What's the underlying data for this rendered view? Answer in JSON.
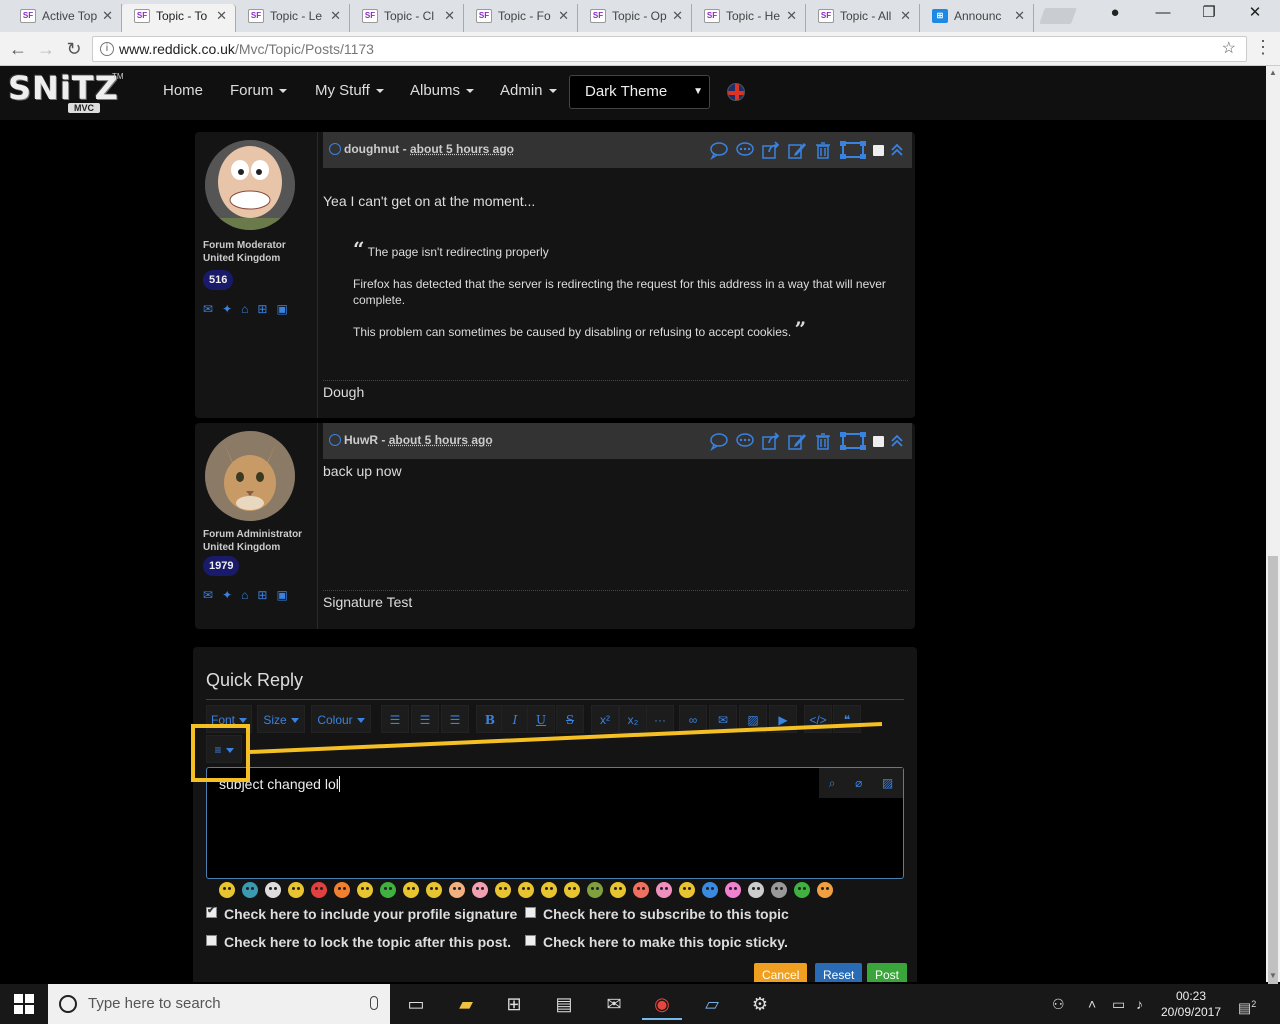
{
  "browser": {
    "tabs": [
      {
        "label": "Active Top",
        "favicon": "SF",
        "active": false
      },
      {
        "label": "Topic - To",
        "favicon": "SF",
        "active": true
      },
      {
        "label": "Topic - Le",
        "favicon": "SF",
        "active": false
      },
      {
        "label": "Topic - Cl",
        "favicon": "SF",
        "active": false
      },
      {
        "label": "Topic - Fo",
        "favicon": "SF",
        "active": false
      },
      {
        "label": "Topic - Op",
        "favicon": "SF",
        "active": false
      },
      {
        "label": "Topic - He",
        "favicon": "SF",
        "active": false
      },
      {
        "label": "Topic - All",
        "favicon": "SF",
        "active": false
      },
      {
        "label": "Announc",
        "favicon": "win",
        "active": false
      }
    ],
    "url_host": "www.reddick.co.uk",
    "url_path": "/Mvc/Topic/Posts/1173"
  },
  "site": {
    "logo_text": "SNiTZ",
    "logo_sub": "MVC",
    "logo_tm": "TM",
    "nav": [
      "Home",
      "Forum",
      "My Stuff",
      "Albums",
      "Admin"
    ],
    "nav_dropdowns": [
      false,
      true,
      true,
      true,
      true
    ],
    "theme_select": "Dark Theme"
  },
  "posts": [
    {
      "author": "doughnut",
      "separator": "-",
      "time": "about 5 hours ago",
      "rank": "Forum Moderator",
      "country": "United Kingdom",
      "post_count": "516",
      "body": "Yea I can't get on at the moment...",
      "quote": [
        "The page isn't redirecting properly",
        "Firefox has detected that the server is redirecting the request for this address in a way that will never complete.",
        "This problem can sometimes be caused by disabling or refusing to accept cookies."
      ],
      "signature": "Dough"
    },
    {
      "author": "HuwR",
      "separator": "-",
      "time": "about 5 hours ago",
      "rank": "Forum Administrator",
      "country": "United Kingdom",
      "post_count": "1979",
      "body": "back up now",
      "signature": "Signature Test"
    }
  ],
  "quick_reply": {
    "title": "Quick Reply",
    "toolbar": {
      "font": "Font",
      "size": "Size",
      "colour": "Colour"
    },
    "editor_text": "subject changed lol",
    "options": {
      "include_signature": "Check here to include your profile signature",
      "subscribe": "Check here to subscribe to this topic",
      "lock": "Check here to lock the topic after this post.",
      "sticky": "Check here to make this topic sticky."
    },
    "buttons": {
      "cancel": "Cancel",
      "reset": "Reset",
      "post": "Post"
    },
    "button_colors": {
      "cancel": "#f0a020",
      "reset": "#2a6bb5",
      "post": "#3aa53a"
    }
  },
  "taskbar": {
    "search_placeholder": "Type here to search",
    "time": "00:23",
    "date": "20/09/2017",
    "notifications": "2"
  },
  "colors": {
    "accent": "#3a82e0",
    "highlight": "#f5c024"
  }
}
